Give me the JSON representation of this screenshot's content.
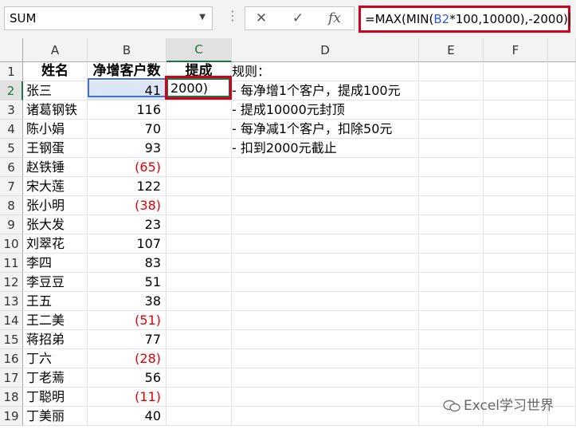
{
  "name_box": "SUM",
  "formula_bar": {
    "cancel_icon": "✕",
    "enter_icon": "✓",
    "fx_icon": "fx",
    "formula_prefix": "=MAX(MIN(",
    "formula_ref": "B2",
    "formula_suffix": "*100,10000),-2000)"
  },
  "columns": [
    "A",
    "B",
    "C",
    "D",
    "E",
    "F"
  ],
  "rows": [
    "1",
    "2",
    "3",
    "4",
    "5",
    "6",
    "7",
    "8",
    "9",
    "10",
    "11",
    "12",
    "13",
    "14",
    "15",
    "16",
    "17",
    "18",
    "19"
  ],
  "headers": {
    "name": "姓名",
    "count": "净增客户数",
    "commission": "提成"
  },
  "active_cell_text": "2000)",
  "data_rows": [
    {
      "name": "张三",
      "value": "41"
    },
    {
      "name": "诸葛钢铁",
      "value": "116"
    },
    {
      "name": "陈小娟",
      "value": "70"
    },
    {
      "name": "王钢蛋",
      "value": "93"
    },
    {
      "name": "赵铁锤",
      "value": "(65)"
    },
    {
      "name": "宋大莲",
      "value": "122"
    },
    {
      "name": "张小明",
      "value": "(38)"
    },
    {
      "name": "张大发",
      "value": "23"
    },
    {
      "name": "刘翠花",
      "value": "107"
    },
    {
      "name": "李四",
      "value": "83"
    },
    {
      "name": "李豆豆",
      "value": "51"
    },
    {
      "name": "王五",
      "value": "38"
    },
    {
      "name": "王二美",
      "value": "(51)"
    },
    {
      "name": "蒋招弟",
      "value": "77"
    },
    {
      "name": "丁六",
      "value": "(28)"
    },
    {
      "name": "丁老蔫",
      "value": "56"
    },
    {
      "name": "丁聪明",
      "value": "(11)"
    },
    {
      "name": "丁美丽",
      "value": "40"
    }
  ],
  "rules": [
    "规则：",
    "- 每净增1个客户，提成100元",
    "- 提成10000元封顶",
    "- 每净减1个客户，扣除50元",
    "- 扣到2000元截止"
  ],
  "watermark": "Excel学习世界",
  "colors": {
    "accent_green": "#217346",
    "highlight_red": "#d0021b",
    "negative_red": "#e00000",
    "ref_blue": "#2f5bd1"
  }
}
